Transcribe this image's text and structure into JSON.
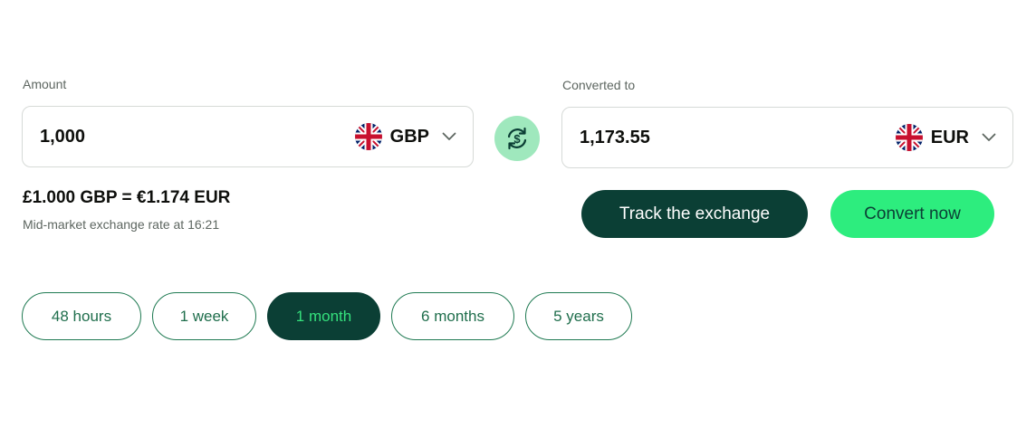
{
  "amount": {
    "label": "Amount",
    "value": "1,000",
    "currency_code": "GBP",
    "flag_icon": "uk-flag-icon"
  },
  "converted": {
    "label": "Converted to",
    "value": "1,173.55",
    "currency_code": "EUR",
    "flag_icon": "uk-flag-icon"
  },
  "swap_icon": "currency-swap-icon",
  "rate": {
    "summary": "£1.000 GBP = €1.174 EUR",
    "note": "Mid-market exchange rate at 16:21"
  },
  "actions": {
    "track_label": "Track the exchange",
    "convert_label": "Convert now"
  },
  "periods": {
    "items": [
      "48 hours",
      "1 week",
      "1 month",
      "6 months",
      "5 years"
    ],
    "selected": "1 month"
  },
  "colors": {
    "dark_green": "#0b3f35",
    "bright_green": "#2ded7e",
    "swap_bg": "#9fe8bd",
    "outline_green": "#1f7a52"
  }
}
